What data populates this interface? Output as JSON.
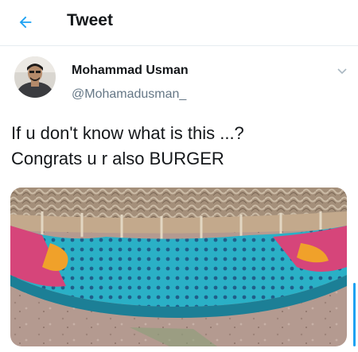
{
  "header": {
    "title": "Tweet",
    "back_icon": "arrow-left-icon",
    "accent_color": "#1da1f2"
  },
  "tweet": {
    "author": {
      "display_name": "Mohammad Usman",
      "handle": "@Mohamadusman_",
      "avatar_icon": "profile-photo"
    },
    "menu_icon": "chevron-down-icon",
    "text": "If u don't know what is this ...?\nCongrats u r also BURGER",
    "media": {
      "type": "photo",
      "description_icon": "photo-charpai-bed-with-cloth"
    }
  }
}
